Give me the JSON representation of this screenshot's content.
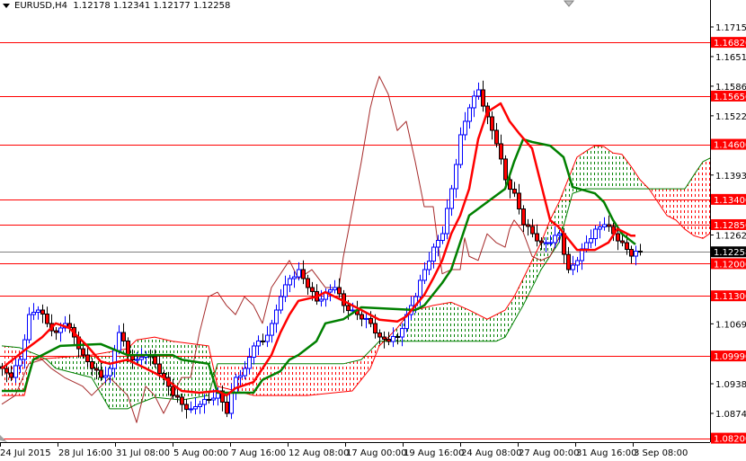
{
  "header": {
    "symbol": "EURUSD,H4",
    "ohlc": "1.12178 1.12341 1.12177 1.12258"
  },
  "colors": {
    "level": "#ff0000",
    "current_price_line": "#808080",
    "bull_candle": "#0000ff",
    "bear_candle": "#ff0000",
    "tenkan": "#ff0000",
    "kijun": "#008000",
    "chikou": "#a52a2a",
    "cloud_up": "#008000",
    "cloud_down": "#ff0000"
  },
  "chart_data": {
    "type": "candlestick",
    "symbol": "EURUSD",
    "timeframe": "H4",
    "ylim": [
      1.0795,
      1.1728
    ],
    "price_ticks": [
      "1.17155",
      "1.16510",
      "1.15865",
      "1.15220",
      "1.13930",
      "1.12625",
      "1.10690",
      "1.09385",
      "1.08740"
    ],
    "levels": [
      "1.16820",
      "1.15650",
      "1.14600",
      "1.13400",
      "1.12850",
      "1.12000",
      "1.11300",
      "1.09990",
      "1.08200"
    ],
    "current_price": "1.12258",
    "time_labels": [
      "24 Jul 2015",
      "28 Jul 16:00",
      "31 Jul 08:00",
      "5 Aug 00:00",
      "7 Aug 16:00",
      "12 Aug 08:00",
      "17 Aug 00:00",
      "19 Aug 16:00",
      "24 Aug 08:00",
      "27 Aug 00:00",
      "31 Aug 16:00",
      "3 Sep 08:00"
    ],
    "bars_per_time_label": 12.8,
    "closes_every_2_bars": [
      1.09718,
      1.09523,
      1.09914,
      1.10892,
      1.1099,
      1.10697,
      1.10501,
      1.10697,
      1.10403,
      1.10012,
      1.09718,
      1.09523,
      1.09718,
      1.10501,
      1.10012,
      1.09914,
      1.10012,
      1.09816,
      1.09523,
      1.09131,
      1.08935,
      1.08838,
      1.08935,
      1.09033,
      1.09229,
      1.0874,
      1.09523,
      1.09718,
      1.10208,
      1.10305,
      1.10697,
      1.11284,
      1.11675,
      1.11871,
      1.1148,
      1.11186,
      1.11382,
      1.1148,
      1.11088,
      1.1099,
      1.10795,
      1.10697,
      1.10403,
      1.10305,
      1.10403,
      1.10892,
      1.11284,
      1.11871,
      1.1236,
      1.12654,
      1.13632,
      1.14807,
      1.15394,
      1.15785,
      1.15198,
      1.14611,
      1.13828,
      1.13535,
      1.1285,
      1.12654,
      1.12458,
      1.12458,
      1.12654,
      1.11871,
      1.12067,
      1.12458,
      1.12752,
      1.1285,
      1.12654,
      1.12458,
      1.12164,
      1.12258
    ],
    "tenkan_sen": [
      [
        0,
        1.0972
      ],
      [
        5,
        1.1011
      ],
      [
        9,
        1.104
      ],
      [
        12,
        1.107
      ],
      [
        15,
        1.106
      ],
      [
        19,
        1.1021
      ],
      [
        22,
        1.0987
      ],
      [
        24,
        1.0982
      ],
      [
        28,
        1.0991
      ],
      [
        32,
        1.0972
      ],
      [
        36,
        1.0952
      ],
      [
        40,
        1.0923
      ],
      [
        44,
        1.0919
      ],
      [
        48,
        1.0923
      ],
      [
        50,
        1.0913
      ],
      [
        52,
        1.0929
      ],
      [
        56,
        1.0942
      ],
      [
        60,
        1.1001
      ],
      [
        62,
        1.105
      ],
      [
        64,
        1.1089
      ],
      [
        66,
        1.1119
      ],
      [
        70,
        1.1128
      ],
      [
        72,
        1.1138
      ],
      [
        76,
        1.1119
      ],
      [
        80,
        1.1099
      ],
      [
        84,
        1.1078
      ],
      [
        88,
        1.1074
      ],
      [
        90,
        1.1085
      ],
      [
        94,
        1.1132
      ],
      [
        96,
        1.1168
      ],
      [
        98,
        1.1207
      ],
      [
        100,
        1.1265
      ],
      [
        102,
        1.1305
      ],
      [
        104,
        1.1363
      ],
      [
        106,
        1.1471
      ],
      [
        108,
        1.153
      ],
      [
        111,
        1.1549
      ],
      [
        113,
        1.151
      ],
      [
        115,
        1.1485
      ],
      [
        118,
        1.1451
      ],
      [
        120,
        1.1373
      ],
      [
        122,
        1.1295
      ],
      [
        124,
        1.1279
      ],
      [
        128,
        1.123
      ],
      [
        132,
        1.123
      ],
      [
        135,
        1.1246
      ],
      [
        137,
        1.1276
      ],
      [
        140,
        1.1261
      ],
      [
        141,
        1.1261
      ]
    ],
    "kijun_sen": [
      [
        0,
        1.0923
      ],
      [
        5,
        1.0923
      ],
      [
        7,
        1.0991
      ],
      [
        13,
        1.1021
      ],
      [
        22,
        1.1025
      ],
      [
        28,
        1.1001
      ],
      [
        38,
        1.1001
      ],
      [
        40,
        1.0991
      ],
      [
        46,
        1.0982
      ],
      [
        48,
        1.0919
      ],
      [
        56,
        1.0919
      ],
      [
        58,
        1.0947
      ],
      [
        62,
        1.0966
      ],
      [
        64,
        1.0991
      ],
      [
        66,
        1.1001
      ],
      [
        70,
        1.1031
      ],
      [
        72,
        1.107
      ],
      [
        76,
        1.1079
      ],
      [
        80,
        1.1105
      ],
      [
        92,
        1.1099
      ],
      [
        94,
        1.1109
      ],
      [
        98,
        1.1158
      ],
      [
        100,
        1.1187
      ],
      [
        102,
        1.1246
      ],
      [
        104,
        1.1305
      ],
      [
        112,
        1.1363
      ],
      [
        114,
        1.1422
      ],
      [
        116,
        1.1471
      ],
      [
        118,
        1.1465
      ],
      [
        122,
        1.1457
      ],
      [
        125,
        1.1432
      ],
      [
        127,
        1.1367
      ],
      [
        132,
        1.1353
      ],
      [
        134,
        1.1334
      ],
      [
        136,
        1.1295
      ],
      [
        138,
        1.1265
      ],
      [
        141,
        1.1242
      ]
    ],
    "chikou_span": [
      [
        0,
        1.0894
      ],
      [
        3,
        1.0913
      ],
      [
        6,
        1.0982
      ],
      [
        9,
        1.0991
      ],
      [
        11,
        1.0972
      ],
      [
        14,
        1.0952
      ],
      [
        18,
        1.0933
      ],
      [
        20,
        1.0913
      ],
      [
        24,
        1.0952
      ],
      [
        28,
        1.0913
      ],
      [
        30,
        1.0854
      ],
      [
        32,
        1.0933
      ],
      [
        34,
        1.0913
      ],
      [
        36,
        1.0874
      ],
      [
        40,
        1.0952
      ],
      [
        42,
        1.0952
      ],
      [
        44,
        1.105
      ],
      [
        46,
        1.1128
      ],
      [
        48,
        1.1138
      ],
      [
        50,
        1.1109
      ],
      [
        52,
        1.1089
      ],
      [
        54,
        1.1128
      ],
      [
        56,
        1.1109
      ],
      [
        58,
        1.107
      ],
      [
        60,
        1.1148
      ],
      [
        64,
        1.1207
      ],
      [
        66,
        1.1167
      ],
      [
        69,
        1.1187
      ],
      [
        72,
        1.1148
      ],
      [
        75,
        1.1148
      ],
      [
        76,
        1.1215
      ],
      [
        77,
        1.1265
      ],
      [
        80,
        1.1422
      ],
      [
        82,
        1.1539
      ],
      [
        83,
        1.1578
      ],
      [
        84,
        1.1608
      ],
      [
        86,
        1.1569
      ],
      [
        88,
        1.149
      ],
      [
        90,
        1.151
      ],
      [
        92,
        1.1422
      ],
      [
        94,
        1.1324
      ],
      [
        96,
        1.1324
      ],
      [
        97,
        1.1246
      ],
      [
        98,
        1.1178
      ],
      [
        100,
        1.1187
      ],
      [
        102,
        1.1187
      ],
      [
        103,
        1.1256
      ],
      [
        104,
        1.1216
      ],
      [
        106,
        1.1207
      ],
      [
        108,
        1.1265
      ],
      [
        110,
        1.1246
      ],
      [
        112,
        1.1236
      ],
      [
        113,
        1.1275
      ],
      [
        114,
        1.1295
      ],
      [
        116,
        1.1269
      ],
      [
        118,
        1.1216
      ],
      [
        120,
        1.1207
      ],
      [
        122,
        1.1216
      ],
      [
        124,
        1.1256
      ]
    ],
    "senkou_span_a": [
      [
        0,
        1.0913
      ],
      [
        5,
        1.0913
      ],
      [
        7,
        1.0991
      ],
      [
        12,
        1.0995
      ],
      [
        20,
        1.1001
      ],
      [
        28,
        1.1015
      ],
      [
        30,
        1.1034
      ],
      [
        34,
        1.104
      ],
      [
        38,
        1.1031
      ],
      [
        46,
        1.1021
      ],
      [
        48,
        1.0933
      ],
      [
        56,
        1.0913
      ],
      [
        68,
        1.0913
      ],
      [
        78,
        1.0923
      ],
      [
        82,
        1.0972
      ],
      [
        84,
        1.1021
      ],
      [
        86,
        1.104
      ],
      [
        88,
        1.106
      ],
      [
        90,
        1.1085
      ],
      [
        92,
        1.1099
      ],
      [
        96,
        1.1109
      ],
      [
        100,
        1.1116
      ],
      [
        104,
        1.1099
      ],
      [
        108,
        1.1079
      ],
      [
        112,
        1.1099
      ],
      [
        114,
        1.1128
      ],
      [
        116,
        1.1167
      ],
      [
        118,
        1.1207
      ],
      [
        120,
        1.1246
      ],
      [
        122,
        1.1295
      ],
      [
        124,
        1.1334
      ],
      [
        126,
        1.1383
      ],
      [
        128,
        1.1432
      ],
      [
        130,
        1.1445
      ],
      [
        132,
        1.1457
      ],
      [
        134,
        1.1455
      ],
      [
        136,
        1.1441
      ],
      [
        138,
        1.1438
      ],
      [
        140,
        1.1412
      ],
      [
        142,
        1.1383
      ],
      [
        144,
        1.1363
      ],
      [
        146,
        1.1334
      ],
      [
        148,
        1.1305
      ],
      [
        150,
        1.1295
      ],
      [
        152,
        1.1275
      ],
      [
        154,
        1.1261
      ],
      [
        156,
        1.1255
      ],
      [
        158,
        1.1269
      ]
    ],
    "senkou_span_b": [
      [
        0,
        1.1021
      ],
      [
        4,
        1.1017
      ],
      [
        8,
        1.1001
      ],
      [
        10,
        1.0991
      ],
      [
        12,
        1.0972
      ],
      [
        16,
        1.0962
      ],
      [
        20,
        1.0952
      ],
      [
        24,
        1.0884
      ],
      [
        28,
        1.0884
      ],
      [
        30,
        1.0894
      ],
      [
        34,
        1.0909
      ],
      [
        40,
        1.0903
      ],
      [
        46,
        1.0913
      ],
      [
        48,
        1.0982
      ],
      [
        60,
        1.0982
      ],
      [
        76,
        1.0982
      ],
      [
        80,
        1.0991
      ],
      [
        84,
        1.1031
      ],
      [
        110,
        1.1031
      ],
      [
        112,
        1.104
      ],
      [
        116,
        1.1109
      ],
      [
        120,
        1.1187
      ],
      [
        124,
        1.1246
      ],
      [
        127,
        1.1353
      ],
      [
        130,
        1.1363
      ],
      [
        152,
        1.1363
      ],
      [
        154,
        1.1393
      ],
      [
        156,
        1.1422
      ],
      [
        158,
        1.1432
      ]
    ]
  }
}
